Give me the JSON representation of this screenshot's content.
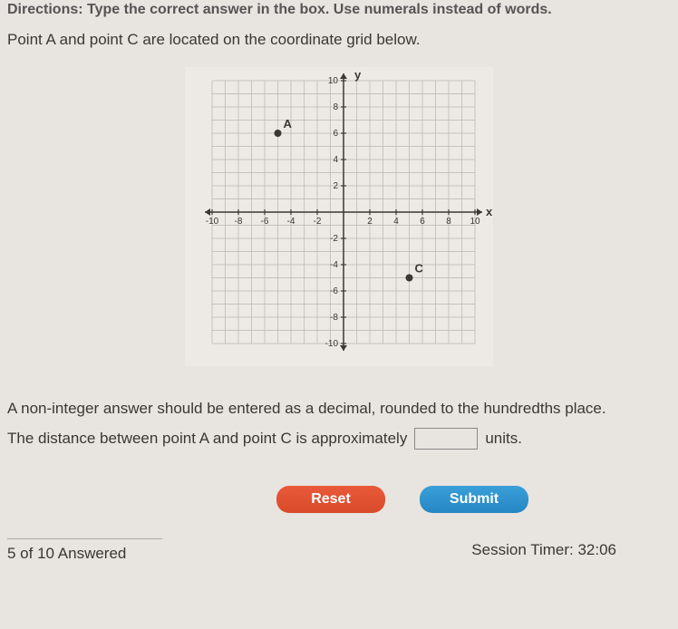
{
  "directions": "Directions: Type the correct answer in the box. Use numerals instead of words.",
  "question": "Point A and point C are located on the coordinate grid below.",
  "hint": "A non-integer answer should be entered as a decimal, rounded to the hundredths place.",
  "answer_prefix": "The distance between point A and point C is approximately",
  "answer_suffix": "units.",
  "answer_value": "",
  "buttons": {
    "reset": "Reset",
    "submit": "Submit"
  },
  "footer": {
    "progress": "5 of 10 Answered",
    "timer": "Session Timer: 32:06"
  },
  "chart_data": {
    "type": "scatter",
    "xlabel": "x",
    "ylabel": "y",
    "xlim": [
      -10,
      10
    ],
    "ylim": [
      -10,
      10
    ],
    "x_ticks": [
      -10,
      -8,
      -6,
      -4,
      -2,
      2,
      4,
      6,
      8,
      10
    ],
    "y_ticks": [
      -10,
      -8,
      -6,
      -4,
      -2,
      2,
      4,
      6,
      8,
      10
    ],
    "points": [
      {
        "label": "A",
        "x": -5,
        "y": 6
      },
      {
        "label": "C",
        "x": 5,
        "y": -5
      }
    ]
  }
}
